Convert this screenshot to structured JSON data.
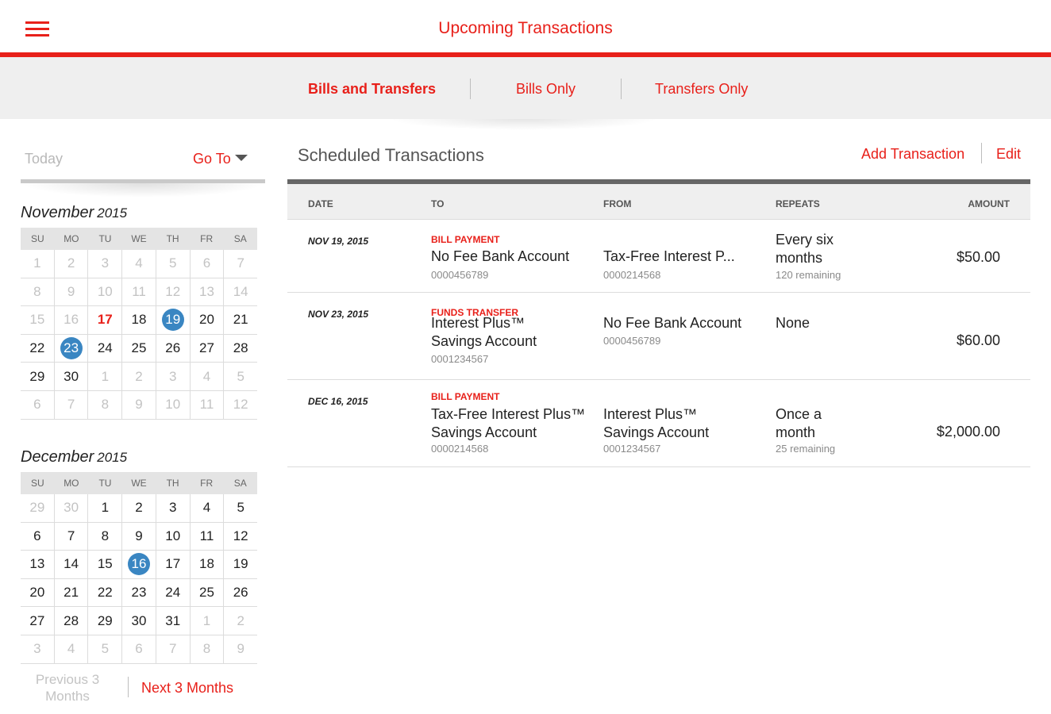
{
  "header": {
    "title": "Upcoming Transactions",
    "menu_icon": "hamburger-menu-icon"
  },
  "segments": [
    {
      "label": "Bills and Transfers",
      "active": true
    },
    {
      "label": "Bills Only",
      "active": false
    },
    {
      "label": "Transfers Only",
      "active": false
    }
  ],
  "sidebar": {
    "today_label": "Today",
    "goto_label": "Go To",
    "weekdays": [
      "SU",
      "MO",
      "TU",
      "WE",
      "TH",
      "FR",
      "SA"
    ],
    "calendars": [
      {
        "month": "November",
        "year": "2015",
        "weeks": [
          [
            {
              "d": "1",
              "m": true
            },
            {
              "d": "2",
              "m": true
            },
            {
              "d": "3",
              "m": true
            },
            {
              "d": "4",
              "m": true
            },
            {
              "d": "5",
              "m": true
            },
            {
              "d": "6",
              "m": true
            },
            {
              "d": "7",
              "m": true
            }
          ],
          [
            {
              "d": "8",
              "m": true
            },
            {
              "d": "9",
              "m": true
            },
            {
              "d": "10",
              "m": true
            },
            {
              "d": "11",
              "m": true
            },
            {
              "d": "12",
              "m": true
            },
            {
              "d": "13",
              "m": true
            },
            {
              "d": "14",
              "m": true
            }
          ],
          [
            {
              "d": "15",
              "m": true
            },
            {
              "d": "16",
              "m": true
            },
            {
              "d": "17",
              "today": true
            },
            {
              "d": "18"
            },
            {
              "d": "19",
              "mark": true
            },
            {
              "d": "20"
            },
            {
              "d": "21"
            }
          ],
          [
            {
              "d": "22"
            },
            {
              "d": "23",
              "mark": true
            },
            {
              "d": "24"
            },
            {
              "d": "25"
            },
            {
              "d": "26"
            },
            {
              "d": "27"
            },
            {
              "d": "28"
            }
          ],
          [
            {
              "d": "29"
            },
            {
              "d": "30"
            },
            {
              "d": "1",
              "m": true
            },
            {
              "d": "2",
              "m": true
            },
            {
              "d": "3",
              "m": true
            },
            {
              "d": "4",
              "m": true
            },
            {
              "d": "5",
              "m": true
            }
          ],
          [
            {
              "d": "6",
              "m": true
            },
            {
              "d": "7",
              "m": true
            },
            {
              "d": "8",
              "m": true
            },
            {
              "d": "9",
              "m": true
            },
            {
              "d": "10",
              "m": true
            },
            {
              "d": "11",
              "m": true
            },
            {
              "d": "12",
              "m": true
            }
          ]
        ]
      },
      {
        "month": "December",
        "year": "2015",
        "weeks": [
          [
            {
              "d": "29",
              "m": true
            },
            {
              "d": "30",
              "m": true
            },
            {
              "d": "1"
            },
            {
              "d": "2"
            },
            {
              "d": "3"
            },
            {
              "d": "4"
            },
            {
              "d": "5"
            }
          ],
          [
            {
              "d": "6"
            },
            {
              "d": "7"
            },
            {
              "d": "8"
            },
            {
              "d": "9"
            },
            {
              "d": "10"
            },
            {
              "d": "11"
            },
            {
              "d": "12"
            }
          ],
          [
            {
              "d": "13"
            },
            {
              "d": "14"
            },
            {
              "d": "15"
            },
            {
              "d": "16",
              "mark": true
            },
            {
              "d": "17"
            },
            {
              "d": "18"
            },
            {
              "d": "19"
            }
          ],
          [
            {
              "d": "20"
            },
            {
              "d": "21"
            },
            {
              "d": "22"
            },
            {
              "d": "23"
            },
            {
              "d": "24"
            },
            {
              "d": "25"
            },
            {
              "d": "26"
            }
          ],
          [
            {
              "d": "27"
            },
            {
              "d": "28"
            },
            {
              "d": "29"
            },
            {
              "d": "30"
            },
            {
              "d": "31"
            },
            {
              "d": "1",
              "m": true
            },
            {
              "d": "2",
              "m": true
            }
          ],
          [
            {
              "d": "3",
              "m": true
            },
            {
              "d": "4",
              "m": true
            },
            {
              "d": "5",
              "m": true
            },
            {
              "d": "6",
              "m": true
            },
            {
              "d": "7",
              "m": true
            },
            {
              "d": "8",
              "m": true
            },
            {
              "d": "9",
              "m": true
            }
          ]
        ]
      }
    ],
    "prev_label": "Previous 3 Months",
    "next_label": "Next 3 Months"
  },
  "main": {
    "title": "Scheduled Transactions",
    "add_label": "Add Transaction",
    "edit_label": "Edit",
    "columns": {
      "date": "DATE",
      "to": "TO",
      "from": "FROM",
      "repeats": "REPEATS",
      "amount": "AMOUNT"
    },
    "rows": [
      {
        "date": "NOV 19, 2015",
        "type": "BILL PAYMENT",
        "to_lines": [
          "No Fee Bank Account"
        ],
        "to_acct": "0000456789",
        "from_lines": [
          "Tax-Free Interest P..."
        ],
        "from_acct": "0000214568",
        "repeat_lines": [
          "Every six",
          "months"
        ],
        "repeat_sub": "120 remaining",
        "amount": "$50.00"
      },
      {
        "date": "NOV 23, 2015",
        "type": "FUNDS TRANSFER",
        "to_lines": [
          "Interest Plus™",
          "Savings Account"
        ],
        "to_acct": "0001234567",
        "from_lines": [
          "No Fee Bank Account"
        ],
        "from_acct": "0000456789",
        "repeat_lines": [
          "None"
        ],
        "repeat_sub": "",
        "amount": "$60.00"
      },
      {
        "date": "DEC 16, 2015",
        "type": "BILL PAYMENT",
        "to_lines": [
          "Tax-Free Interest Plus™",
          "Savings Account"
        ],
        "to_acct": "0000214568",
        "from_lines": [
          "Interest Plus™",
          "Savings Account"
        ],
        "from_acct": "0001234567",
        "repeat_lines": [
          "Once a",
          "month"
        ],
        "repeat_sub": "25 remaining",
        "amount": "$2,000.00"
      }
    ]
  },
  "colors": {
    "accent": "#e8201a",
    "marker": "#3a86c2",
    "bar": "#efefef"
  }
}
